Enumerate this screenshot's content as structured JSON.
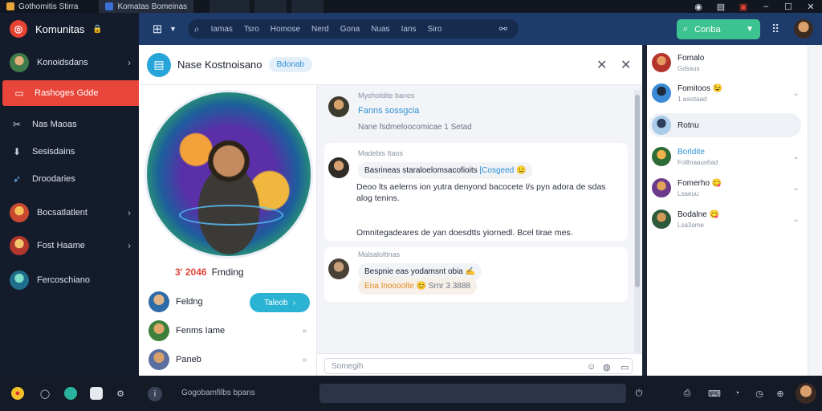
{
  "os": {
    "tabs": [
      {
        "label": "Gothomitis Stirra",
        "icon": "app-icon"
      },
      {
        "label": "Komatas Bomeinas",
        "icon": "game-icon"
      }
    ],
    "window_controls": [
      "profile-icon",
      "notes-icon",
      "record-icon",
      "minimize-icon",
      "maximize-icon",
      "close-icon"
    ]
  },
  "sidebar": {
    "brand": "Komunitas",
    "items": [
      {
        "label": "Konoidsdans",
        "chevron": true
      },
      {
        "label": "Rashoges Gdde",
        "chevron": false,
        "active": true
      },
      {
        "label": "Nas Maoas",
        "chevron": false
      },
      {
        "label": "Sesisdains",
        "chevron": false
      },
      {
        "label": "Droodaries",
        "chevron": false
      },
      {
        "label": "Bocsatlatlent",
        "chevron": true
      },
      {
        "label": "Fost Haame",
        "chevron": true
      },
      {
        "label": "Fercoschiano",
        "chevron": false
      }
    ]
  },
  "header": {
    "search_tabs": [
      "Iamas",
      "Tsro",
      "Homose",
      "Nerd",
      "Gona",
      "Nuas",
      "Ians",
      "Siro"
    ],
    "action_label": "Conba"
  },
  "chat": {
    "title": "Nase Kostnoisano",
    "tag": "Bdonab",
    "profile": {
      "rating_value": "3' 2046",
      "rating_label": "Fmding",
      "follow_label": "Taleob",
      "people": [
        {
          "name": "Feldng"
        },
        {
          "name": "Fenms Iame"
        },
        {
          "name": "Paneb"
        }
      ]
    },
    "messages": [
      {
        "meta": "Myoholdite banos",
        "link": "Fanns sossgcia",
        "text": "Nane fsdmeloocomicae 1 Setad"
      },
      {
        "meta": "Madebis Itaos",
        "pill_text": "Basrineas staraloelomsacofioits",
        "pill_link": "[Cosgeed",
        "body": "Deoo lts aelerns ion yutra denyond bacocete l/s pyn adora de sdas alog tenins.",
        "footer": "Omnitegadeares de yan doesdtts yiornedl. Bcel tirae mes."
      },
      {
        "meta": "Malsaloltinas",
        "pill_text": "Bespnie eas yodamsnt obia",
        "pill_sub_orange": "Ena Inoooolte",
        "pill_sub_grey": "Srnr 3 3888"
      }
    ],
    "composer_placeholder": "Somegih"
  },
  "contacts": [
    {
      "name": "Fomalo",
      "sub": "Gdsaus",
      "chev": false
    },
    {
      "name": "Fomitoos",
      "sub": "1 asistaad",
      "chev": true,
      "emoji": "😉"
    },
    {
      "name": "Rotnu",
      "sub": "",
      "chev": false,
      "selected": true
    },
    {
      "name": "Borldite",
      "sub": "Folltnaaus6ad",
      "chev": true,
      "blue": true
    },
    {
      "name": "Fomerho",
      "sub": "Lsaeuu",
      "chev": true,
      "emoji": "😋"
    },
    {
      "name": "Bodalne",
      "sub": "Lsa3ame",
      "chev": true,
      "emoji": "😋"
    }
  ],
  "taskbar": {
    "label": "Gogobamfilbs bpans"
  },
  "colors": {
    "accent_red": "#e8463a",
    "accent_teal": "#3dc292",
    "header_blue": "#1e3c6b",
    "link_blue": "#2d8fd1"
  }
}
